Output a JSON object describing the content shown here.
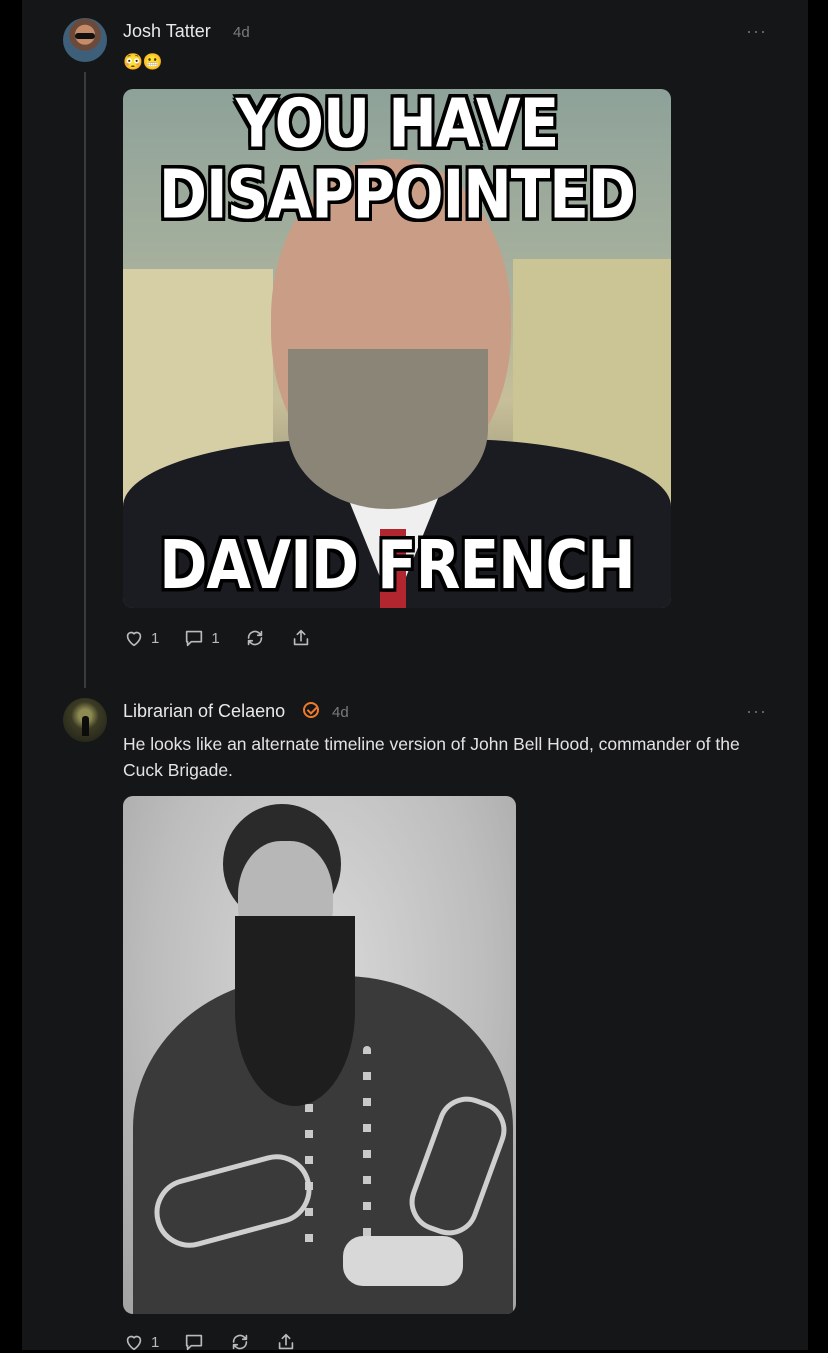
{
  "post": {
    "author": "Josh Tatter",
    "time": "4d",
    "more_label": "···",
    "emoji_text": "😳😬",
    "image": {
      "caption_top_line1": "YOU HAVE",
      "caption_top_line2": "DISAPPOINTED",
      "caption_bottom": "DAVID FRENCH"
    },
    "actions": {
      "likes": "1",
      "comments": "1"
    }
  },
  "reply": {
    "author": "Librarian of Celaeno",
    "verified": true,
    "time": "4d",
    "more_label": "···",
    "text": "He looks like an alternate timeline version of John Bell Hood, commander of the Cuck Brigade.",
    "actions": {
      "likes": "1"
    }
  },
  "colors": {
    "background": "#151618",
    "verified_badge": "#f07a2c",
    "muted_text": "#7a7b7e"
  },
  "icons": [
    "heart-icon",
    "comment-icon",
    "repost-icon",
    "share-icon",
    "more-icon",
    "verified-icon"
  ]
}
